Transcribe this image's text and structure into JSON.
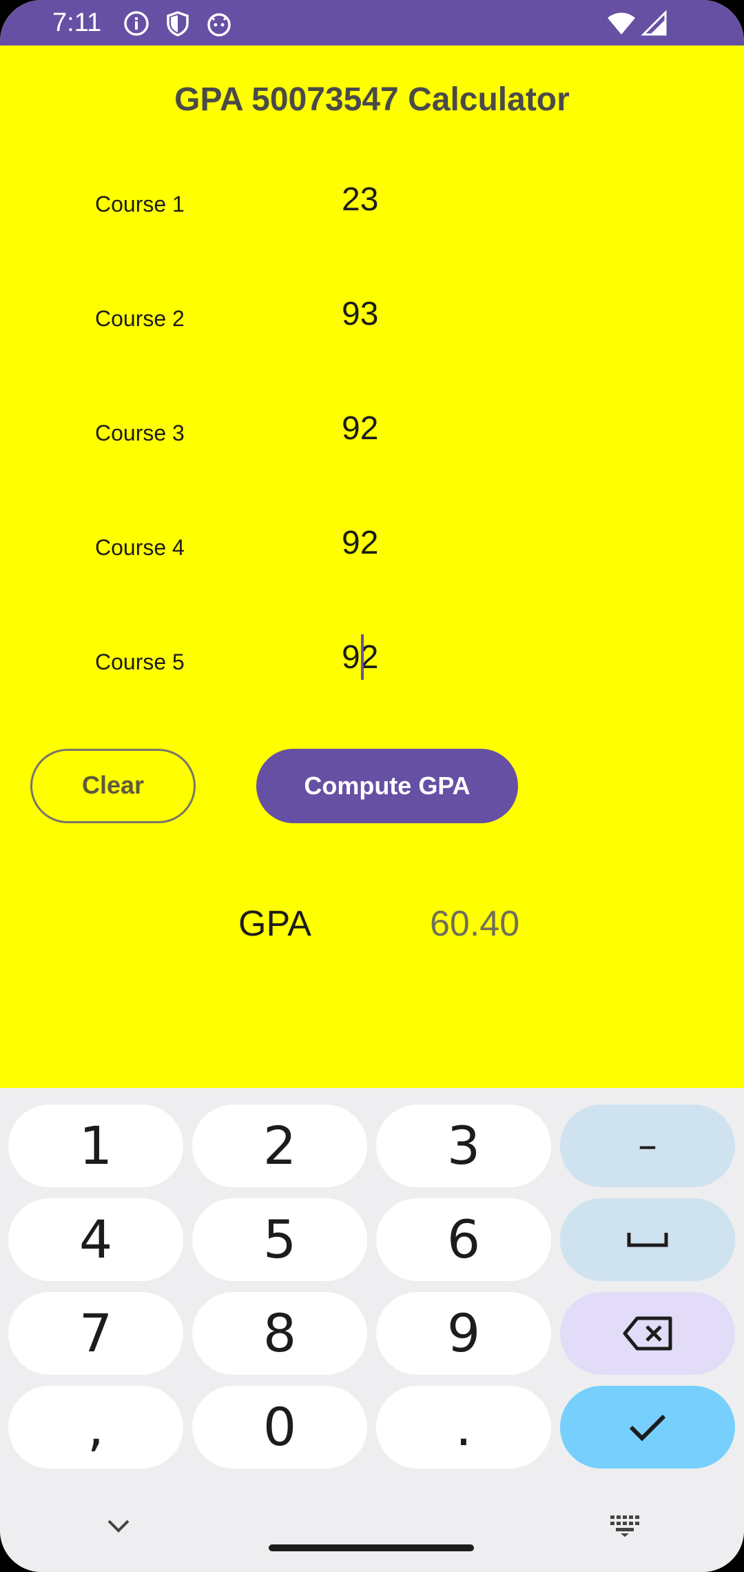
{
  "status_bar": {
    "time": "7:11",
    "icons": [
      "info-icon",
      "shield-icon",
      "android-face-icon",
      "wifi-icon",
      "signal-icon"
    ],
    "color": "#6650a4"
  },
  "app": {
    "title": "GPA 50073547 Calculator",
    "background": "#ffff00",
    "courses": [
      {
        "label": "Course 1",
        "value": "23"
      },
      {
        "label": "Course 2",
        "value": "93"
      },
      {
        "label": "Course 3",
        "value": "92"
      },
      {
        "label": "Course 4",
        "value": "92"
      },
      {
        "label": "Course 5",
        "value": "92"
      }
    ],
    "clear_label": "Clear",
    "compute_label": "Compute GPA",
    "gpa_label": "GPA",
    "gpa_value": "60.40",
    "accent": "#6650a4"
  },
  "keyboard": {
    "keys": [
      {
        "label": "1"
      },
      {
        "label": "2"
      },
      {
        "label": "3"
      },
      {
        "label": "–"
      },
      {
        "label": "4"
      },
      {
        "label": "5"
      },
      {
        "label": "6"
      },
      {
        "label": "space-icon"
      },
      {
        "label": "7"
      },
      {
        "label": "8"
      },
      {
        "label": "9"
      },
      {
        "label": "backspace-icon"
      },
      {
        "label": ","
      },
      {
        "label": "0"
      },
      {
        "label": "."
      },
      {
        "label": "check-icon"
      }
    ],
    "nav_icons": [
      "chevron-down-icon",
      "keyboard-icon"
    ]
  }
}
